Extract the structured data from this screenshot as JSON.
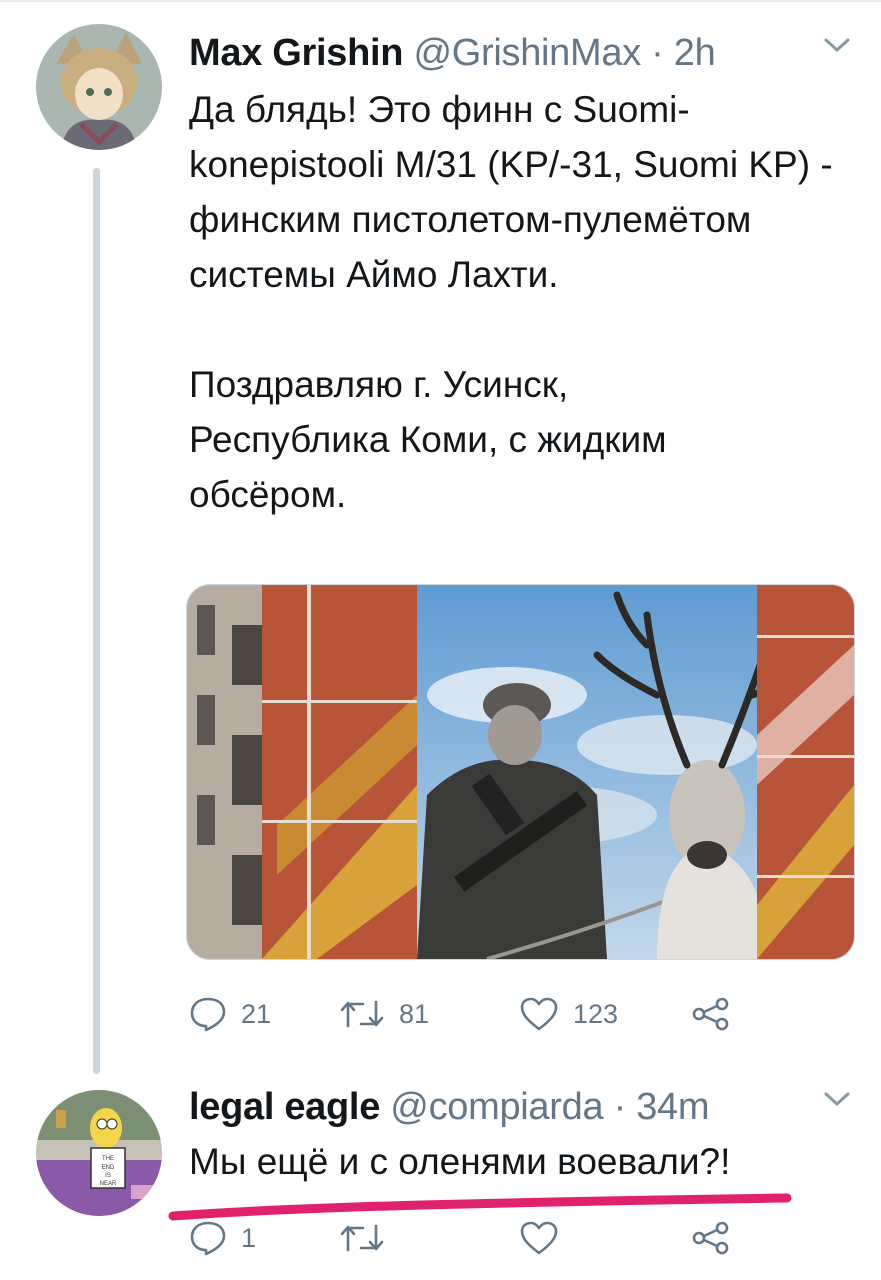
{
  "tweets": [
    {
      "author": {
        "name": "Max Grishin",
        "handle": "@GrishinMax",
        "avatar_icon": "anime-avatar"
      },
      "time": "2h",
      "paragraphs": [
        "Да блядь! Это финн с Suomi-konepistooli M/31 (KP/-31, Suomi KP) - финским пистолетом-пулемётом системы Аймо Лахти.",
        "Поздравляю г. Усинск, Республика Коми, с жидким обсёром."
      ],
      "actions": {
        "replies": "21",
        "retweets": "81",
        "likes": "123"
      }
    },
    {
      "author": {
        "name": "legal eagle",
        "handle": "@compiarda",
        "avatar_icon": "homer-sign-avatar",
        "avatar_sign_text": "THE END IS NEAR"
      },
      "time": "34m",
      "paragraphs": [
        "Мы ещё и с оленями воевали?!"
      ],
      "actions": {
        "replies": "1",
        "retweets": "",
        "likes": ""
      }
    }
  ],
  "icons": [
    "chevron-down-icon",
    "reply-icon",
    "retweet-icon",
    "like-icon",
    "share-icon"
  ],
  "colors": {
    "text": "#14171a",
    "secondary": "#657786",
    "thread_line": "#ccd6dd",
    "highlight": "#e0226e"
  }
}
